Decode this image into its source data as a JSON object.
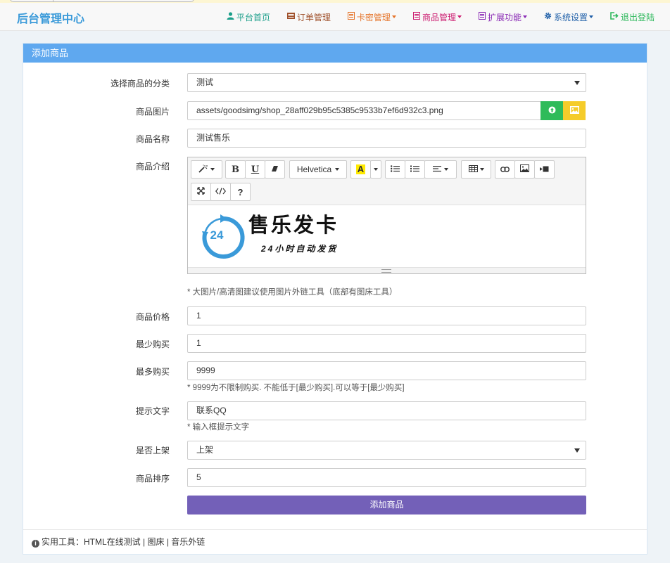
{
  "nav": {
    "brand": "后台管理中心",
    "items": [
      {
        "label": "平台首页",
        "icon": "user-icon",
        "color": "#1b9e8a",
        "dropdown": false
      },
      {
        "label": "订单管理",
        "icon": "list-icon",
        "color": "#a0522d",
        "dropdown": false
      },
      {
        "label": "卡密管理",
        "icon": "card-icon",
        "color": "#e5742a",
        "dropdown": true
      },
      {
        "label": "商品管理",
        "icon": "goods-icon",
        "color": "#cc1f72",
        "dropdown": true
      },
      {
        "label": "扩展功能",
        "icon": "extend-icon",
        "color": "#8a2bb5",
        "dropdown": true
      },
      {
        "label": "系统设置",
        "icon": "gear-icon",
        "color": "#1f5fa8",
        "dropdown": true
      },
      {
        "label": "退出登陆",
        "icon": "logout-icon",
        "color": "#2eb85c",
        "dropdown": false
      }
    ]
  },
  "panel": {
    "title": "添加商品"
  },
  "form": {
    "category": {
      "label": "选择商品的分类",
      "value": "测试"
    },
    "image": {
      "label": "商品图片",
      "value": "assets/goodsimg/shop_28aff029b95c5385c9533b7ef6d932c3.png"
    },
    "name": {
      "label": "商品名称",
      "value": "测试售乐"
    },
    "intro": {
      "label": "商品介绍",
      "help": "* 大图片/高清图建议使用图片外链工具（底部有图床工具）"
    },
    "price": {
      "label": "商品价格",
      "value": "1"
    },
    "min_buy": {
      "label": "最少购买",
      "value": "1"
    },
    "max_buy": {
      "label": "最多购买",
      "value": "9999",
      "help": "* 9999为不限制购买. 不能低于[最少购买].可以等于[最少购买]"
    },
    "tip": {
      "label": "提示文字",
      "value": "联系QQ",
      "help": "* 输入框提示文字"
    },
    "on_shelf": {
      "label": "是否上架",
      "value": "上架"
    },
    "sort": {
      "label": "商品排序",
      "value": "5"
    },
    "submit": "添加商品"
  },
  "editor": {
    "font": "Helvetica",
    "logo": {
      "badge": "24",
      "title": "售乐发卡",
      "subtitle": "24小时自动发货",
      "color": "#3a9ad9"
    }
  },
  "footer": {
    "prefix": "实用工具：",
    "links": [
      "HTML在线测试",
      "图床",
      "音乐外链"
    ]
  }
}
